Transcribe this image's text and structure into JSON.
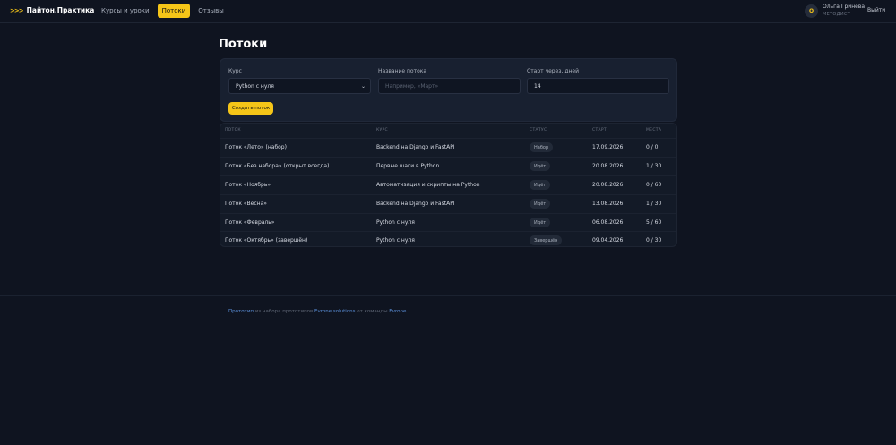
{
  "header": {
    "logo_chevrons": ">>>",
    "logo_text": "Пайтон.Практика",
    "nav": [
      {
        "label": "Курсы и уроки",
        "active": false
      },
      {
        "label": "Потоки",
        "active": true
      },
      {
        "label": "Отзывы",
        "active": false
      }
    ],
    "user": {
      "initial": "О",
      "name": "Ольга Гринёва",
      "role": "МЕТОДИСТ"
    },
    "logout_label": "Выйти"
  },
  "page": {
    "title": "Потоки"
  },
  "form": {
    "course_label": "Курс",
    "course_value": "Python с нуля",
    "name_label": "Название потока",
    "name_placeholder": "Например, «Март»",
    "start_label": "Старт через, дней",
    "start_value": "14",
    "create_button": "Создать поток"
  },
  "table": {
    "headers": [
      "ПОТОК",
      "КУРС",
      "СТАТУС",
      "СТАРТ",
      "МЕСТА"
    ],
    "rows": [
      {
        "stream": "Поток «Лето» (набор)",
        "course": "Backend на Django и FastAPI",
        "status": "Набор",
        "start": "17.09.2026",
        "seats": "0 / 0"
      },
      {
        "stream": "Поток «Без набора» (открыт всегда)",
        "course": "Первые шаги в Python",
        "status": "Идёт",
        "start": "20.08.2026",
        "seats": "1 / 30"
      },
      {
        "stream": "Поток «Ноябрь»",
        "course": "Автоматизация и скрипты на Python",
        "status": "Идёт",
        "start": "20.08.2026",
        "seats": "0 / 60"
      },
      {
        "stream": "Поток «Весна»",
        "course": "Backend на Django и FastAPI",
        "status": "Идёт",
        "start": "13.08.2026",
        "seats": "1 / 30"
      },
      {
        "stream": "Поток «Февраль»",
        "course": "Python с нуля",
        "status": "Идёт",
        "start": "06.08.2026",
        "seats": "5 / 60"
      },
      {
        "stream": "Поток «Октябрь» (завершён)",
        "course": "Python с нуля",
        "status": "Завершён",
        "start": "09.04.2026",
        "seats": "0 / 30"
      }
    ]
  },
  "footer": {
    "link1": "Прототип",
    "text1": " из набора прототипов ",
    "link2": "Evrone.solutions",
    "text2": " от команды ",
    "link3": "Evrone"
  },
  "colors": {
    "accent": "#f5c518",
    "background": "#0f1420",
    "link": "#5b8fd8"
  }
}
